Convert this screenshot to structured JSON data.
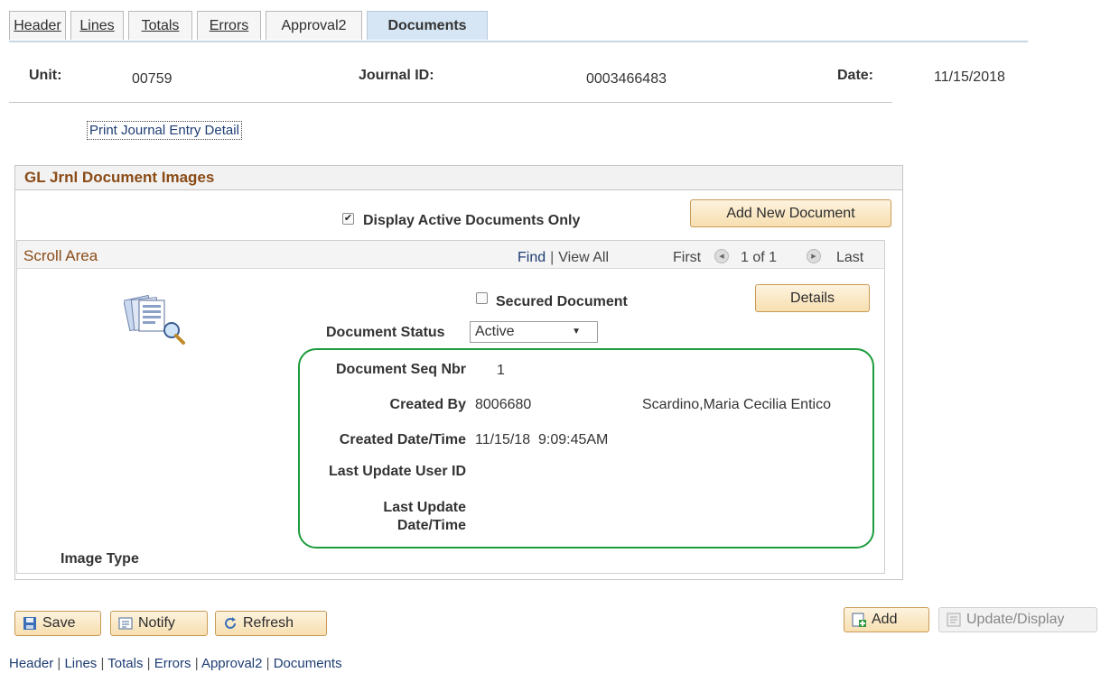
{
  "tabs": [
    {
      "label": "Header",
      "active": false,
      "hotkey_index": 0
    },
    {
      "label": "Lines",
      "active": false,
      "hotkey_index": 0
    },
    {
      "label": "Totals",
      "active": false,
      "hotkey_index": 0
    },
    {
      "label": "Errors",
      "active": false,
      "hotkey_index": 0
    },
    {
      "label": "Approval2",
      "active": false,
      "hotkey_index": -1
    },
    {
      "label": "Documents",
      "active": true,
      "hotkey_index": -1
    }
  ],
  "header": {
    "unit_label": "Unit:",
    "unit_value": "00759",
    "journal_label": "Journal ID:",
    "journal_value": "0003466483",
    "date_label": "Date:",
    "date_value": "11/15/2018"
  },
  "print_link": "Print Journal Entry Detail",
  "group": {
    "title": "GL Jrnl Document Images",
    "display_active_label": "Display Active Documents Only",
    "display_active_checked": true,
    "add_new_button": "Add New Document"
  },
  "scroll": {
    "title": "Scroll Area",
    "find": "Find",
    "view_all": "View All",
    "first": "First",
    "count": "1 of 1",
    "last": "Last",
    "sep": "|"
  },
  "document": {
    "secured_label": "Secured Document",
    "secured_checked": false,
    "details_button": "Details",
    "status_label": "Document Status",
    "status_value": "Active",
    "seq_label": "Document Seq Nbr",
    "seq_value": "1",
    "created_by_label": "Created By",
    "created_by_id": "8006680",
    "created_by_name": "Scardino,Maria Cecilia Entico",
    "created_dt_label": "Created Date/Time",
    "created_dt_value": "11/15/18  9:09:45AM",
    "last_user_label": "Last Update User ID",
    "last_dt_label_1": "Last Update",
    "last_dt_label_2": "Date/Time",
    "image_type_label": "Image Type"
  },
  "toolbar": {
    "save": "Save",
    "notify": "Notify",
    "refresh": "Refresh",
    "add": "Add",
    "update_display": "Update/Display"
  },
  "bottom_links": [
    "Header",
    "Lines",
    "Totals",
    "Errors",
    "Approval2",
    "Documents"
  ],
  "colors": {
    "accent_title": "#8a4b16",
    "link": "#1e3d73",
    "highlight": "#1c9c3c",
    "button_fill": "#f7dfb0"
  }
}
